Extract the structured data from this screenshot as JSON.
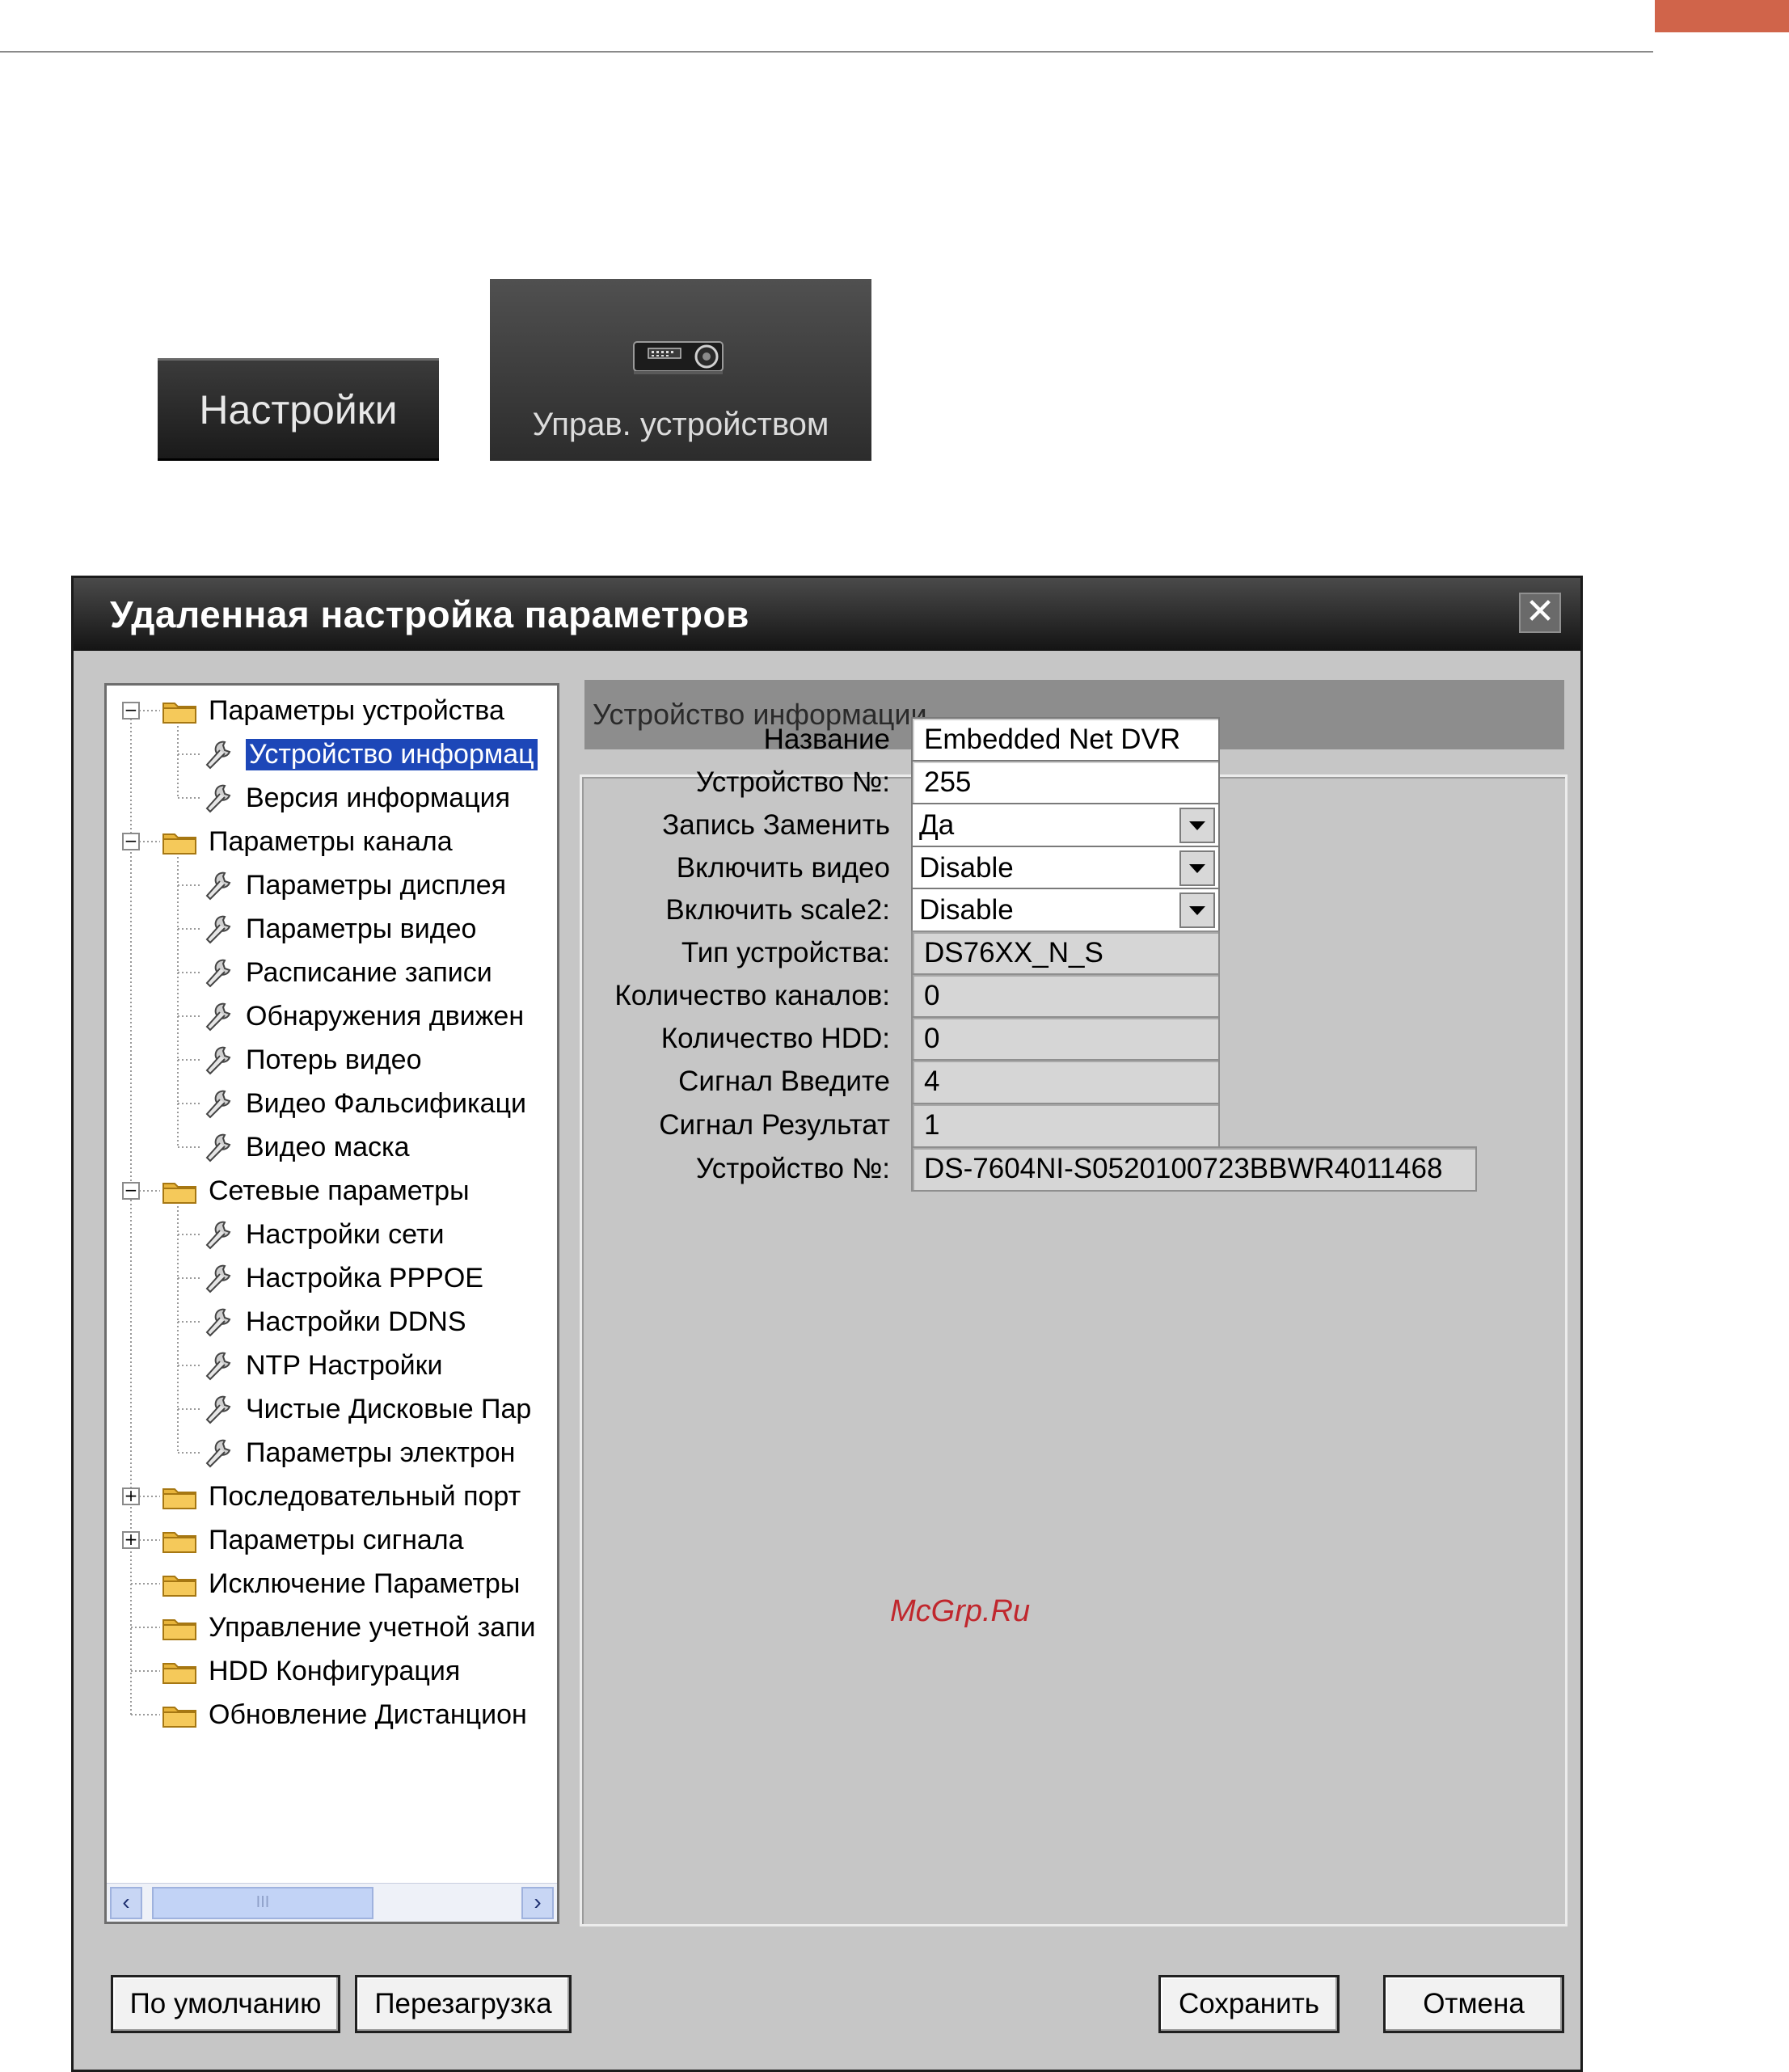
{
  "page_buttons": {
    "settings_label": "Настройки",
    "device_mgmt_label": "Управ. устройством",
    "device_mgmt_icon": "dvr-device-icon"
  },
  "dialog": {
    "title": "Удаленная настройка параметров",
    "close_symbol": "✕",
    "tree": {
      "items": [
        {
          "label": "Параметры устройства",
          "level": 0,
          "type": "folder",
          "expander": "−"
        },
        {
          "label": "Устройство информац",
          "level": 1,
          "type": "leaf",
          "selected": true
        },
        {
          "label": "Версия информация",
          "level": 1,
          "type": "leaf"
        },
        {
          "label": "Параметры канала",
          "level": 0,
          "type": "folder",
          "expander": "−"
        },
        {
          "label": "Параметры дисплея",
          "level": 1,
          "type": "leaf"
        },
        {
          "label": "Параметры видео",
          "level": 1,
          "type": "leaf"
        },
        {
          "label": "Расписание записи",
          "level": 1,
          "type": "leaf"
        },
        {
          "label": "Обнаружения движен",
          "level": 1,
          "type": "leaf"
        },
        {
          "label": "Потерь видео",
          "level": 1,
          "type": "leaf"
        },
        {
          "label": "Видео Фальсификаци",
          "level": 1,
          "type": "leaf"
        },
        {
          "label": "Видео маска",
          "level": 1,
          "type": "leaf"
        },
        {
          "label": "Сетевые параметры",
          "level": 0,
          "type": "folder",
          "expander": "−"
        },
        {
          "label": "Настройки сети",
          "level": 1,
          "type": "leaf"
        },
        {
          "label": "Настройка PPPOE",
          "level": 1,
          "type": "leaf"
        },
        {
          "label": "Настройки DDNS",
          "level": 1,
          "type": "leaf"
        },
        {
          "label": "NTP Настройки",
          "level": 1,
          "type": "leaf"
        },
        {
          "label": "Чистые Дисковые Пар",
          "level": 1,
          "type": "leaf"
        },
        {
          "label": "Параметры электрон",
          "level": 1,
          "type": "leaf"
        },
        {
          "label": "Последовательный порт",
          "level": 0,
          "type": "folder",
          "expander": "+"
        },
        {
          "label": "Параметры сигнала",
          "level": 0,
          "type": "folder",
          "expander": "+"
        },
        {
          "label": "Исключение Параметры",
          "level": 0,
          "type": "folder"
        },
        {
          "label": "Управление учетной запи",
          "level": 0,
          "type": "folder"
        },
        {
          "label": "HDD Конфигурация",
          "level": 0,
          "type": "folder"
        },
        {
          "label": "Обновление Дистанцион",
          "level": 0,
          "type": "folder"
        }
      ],
      "scroll_left": "‹",
      "scroll_right": "›",
      "scroll_grip": "III"
    },
    "section_title": "Устройство информации",
    "fields": [
      {
        "label": "Название",
        "value": "Embedded Net DVR",
        "kind": "edit"
      },
      {
        "label": "Устройство №:",
        "value": "255",
        "kind": "edit"
      },
      {
        "label": "Запись Заменить",
        "value": "Да",
        "kind": "combo"
      },
      {
        "label": "Включить видео",
        "value": "Disable",
        "kind": "combo"
      },
      {
        "label": "Включить scale2:",
        "value": "Disable",
        "kind": "combo"
      },
      {
        "label": "Тип устройства:",
        "value": "DS76XX_N_S",
        "kind": "ro"
      },
      {
        "label": "Количество каналов:",
        "value": "0",
        "kind": "ro"
      },
      {
        "label": "Количество HDD:",
        "value": "0",
        "kind": "ro"
      },
      {
        "label": "Сигнал Введите",
        "value": "4",
        "kind": "ro"
      },
      {
        "label": "Сигнал Результат",
        "value": "1",
        "kind": "ro"
      },
      {
        "label": "Устройство №:",
        "value": "DS-7604NI-S0520100723BBWR4011468",
        "kind": "ro-wide"
      }
    ],
    "watermark": "McGrp.Ru",
    "buttons": {
      "default_label": "По умолчанию",
      "reboot_label": "Перезагрузка",
      "save_label": "Сохранить",
      "cancel_label": "Отмена"
    }
  }
}
